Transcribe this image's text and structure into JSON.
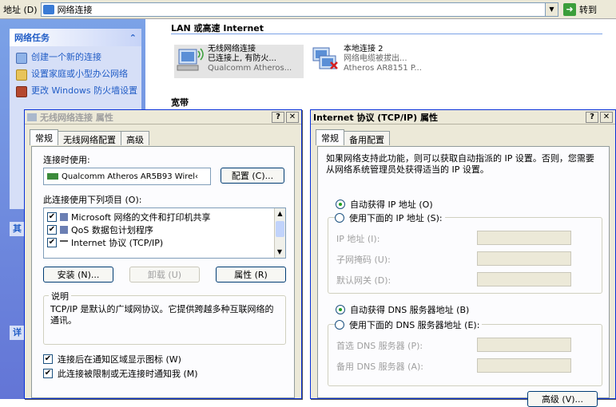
{
  "address_bar": {
    "label": "地址 (D)",
    "value": "网络连接",
    "go_label": "转到"
  },
  "task_panel": {
    "title": "网络任务",
    "items": [
      "创建一个新的连接",
      "设置家庭或小型办公网络",
      "更改 Windows 防火墙设置"
    ]
  },
  "content": {
    "section_title": "LAN 或高速 Internet",
    "broadband_title": "宽带",
    "connections": [
      {
        "name": "无线网络连接",
        "status": "已连接上, 有防火...",
        "device": "Qualcomm Atheros..."
      },
      {
        "name": "本地连接 2",
        "status": "网络电缆被拔出...",
        "device": "Atheros AR8151 P..."
      }
    ]
  },
  "wireless_dialog": {
    "title": "无线网络连接 属性",
    "tabs": [
      "常规",
      "无线网络配置",
      "高级"
    ],
    "connect_using_label": "连接时使用:",
    "adapter": "Qualcomm Atheros AR5B93 Wirel‹",
    "configure_button": "配置 (C)...",
    "items_label": "此连接使用下列项目 (O):",
    "items": [
      "Microsoft 网络的文件和打印机共享",
      "QoS 数据包计划程序",
      "Internet 协议 (TCP/IP)"
    ],
    "install_button": "安装 (N)...",
    "uninstall_button": "卸载 (U)",
    "properties_button": "属性 (R)",
    "description_label": "说明",
    "description_text": "TCP/IP 是默认的广域网协议。它提供跨越多种互联网络的通讯。",
    "checkbox1": "连接后在通知区域显示图标 (W)",
    "checkbox2": "此连接被限制或无连接时通知我 (M)"
  },
  "tcpip_dialog": {
    "title": "Internet 协议 (TCP/IP) 属性",
    "tabs": [
      "常规",
      "备用配置"
    ],
    "intro": "如果网络支持此功能，则可以获取自动指派的 IP 设置。否则，您需要从网络系统管理员处获得适当的 IP 设置。",
    "auto_ip": "自动获得 IP 地址 (O)",
    "manual_ip": "使用下面的 IP 地址 (S):",
    "ip_address": "IP 地址 (I):",
    "subnet_mask": "子网掩码 (U):",
    "default_gateway": "默认网关 (D):",
    "auto_dns": "自动获得 DNS 服务器地址 (B)",
    "manual_dns": "使用下面的 DNS 服务器地址 (E):",
    "preferred_dns": "首选 DNS 服务器 (P):",
    "alternate_dns": "备用 DNS 服务器 (A):",
    "advanced_button": "高级 (V)..."
  },
  "side_misc": {
    "label_a": "其",
    "label_b": "详"
  }
}
